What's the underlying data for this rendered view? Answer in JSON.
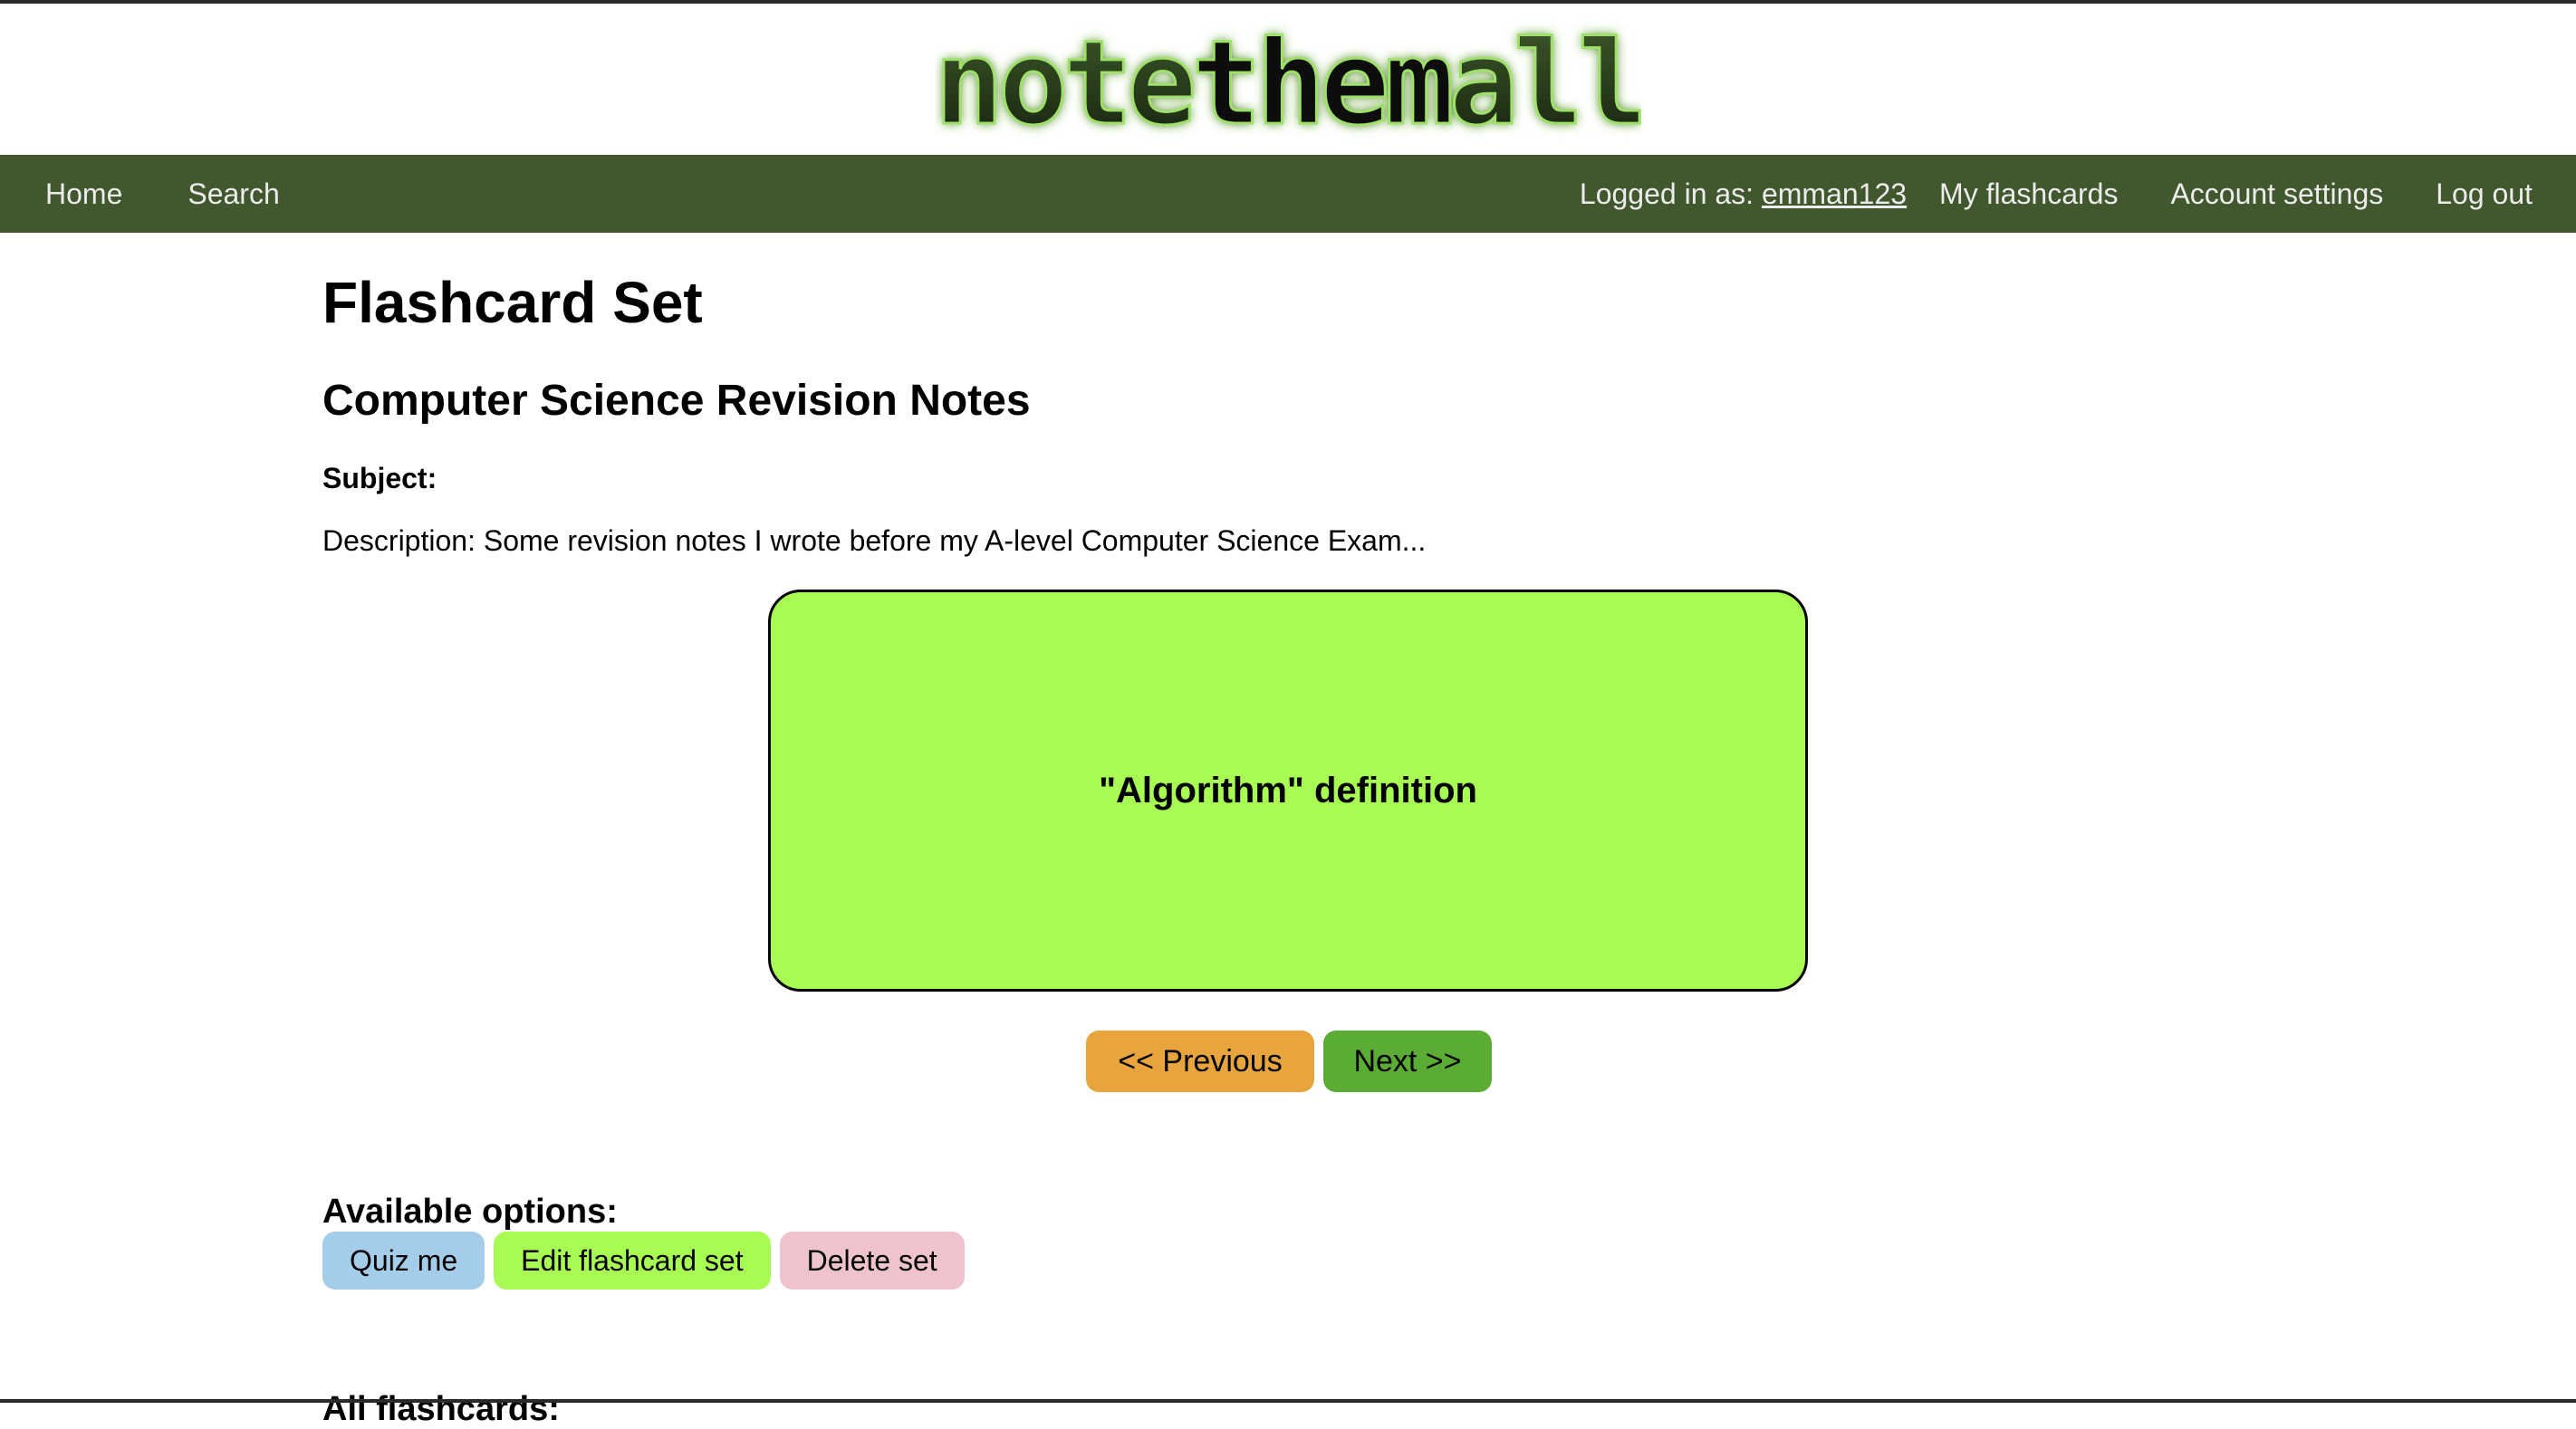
{
  "site": {
    "logo_text": "notethemall",
    "logo_part1": "note",
    "logo_part2": "them",
    "logo_part3": "all"
  },
  "nav": {
    "left": [
      {
        "label": "Home"
      },
      {
        "label": "Search"
      }
    ],
    "logged_in_prefix": "Logged in as: ",
    "username": "emman123",
    "right": [
      {
        "label": "My flashcards"
      },
      {
        "label": "Account settings"
      },
      {
        "label": "Log out"
      }
    ]
  },
  "page": {
    "title": "Flashcard Set",
    "set_title": "Computer Science Revision Notes",
    "subject_label": "Subject:",
    "description": "Description: Some revision notes I wrote before my A-level Computer Science Exam..."
  },
  "card": {
    "text": "\"Algorithm\" definition",
    "color": "#a8fb52"
  },
  "card_controls": {
    "previous_label": "<< Previous",
    "next_label": "Next >>"
  },
  "options": {
    "heading": "Available options:",
    "quiz_label": "Quiz me",
    "edit_label": "Edit flashcard set",
    "delete_label": "Delete set"
  },
  "all_flashcards": {
    "heading": "All flashcards:"
  },
  "colors": {
    "navbar": "#41572d",
    "previous": "#e8a43d",
    "next": "#5aac35",
    "quiz": "#a4cde9",
    "edit": "#a8fb52",
    "delete": "#efc3ce"
  }
}
